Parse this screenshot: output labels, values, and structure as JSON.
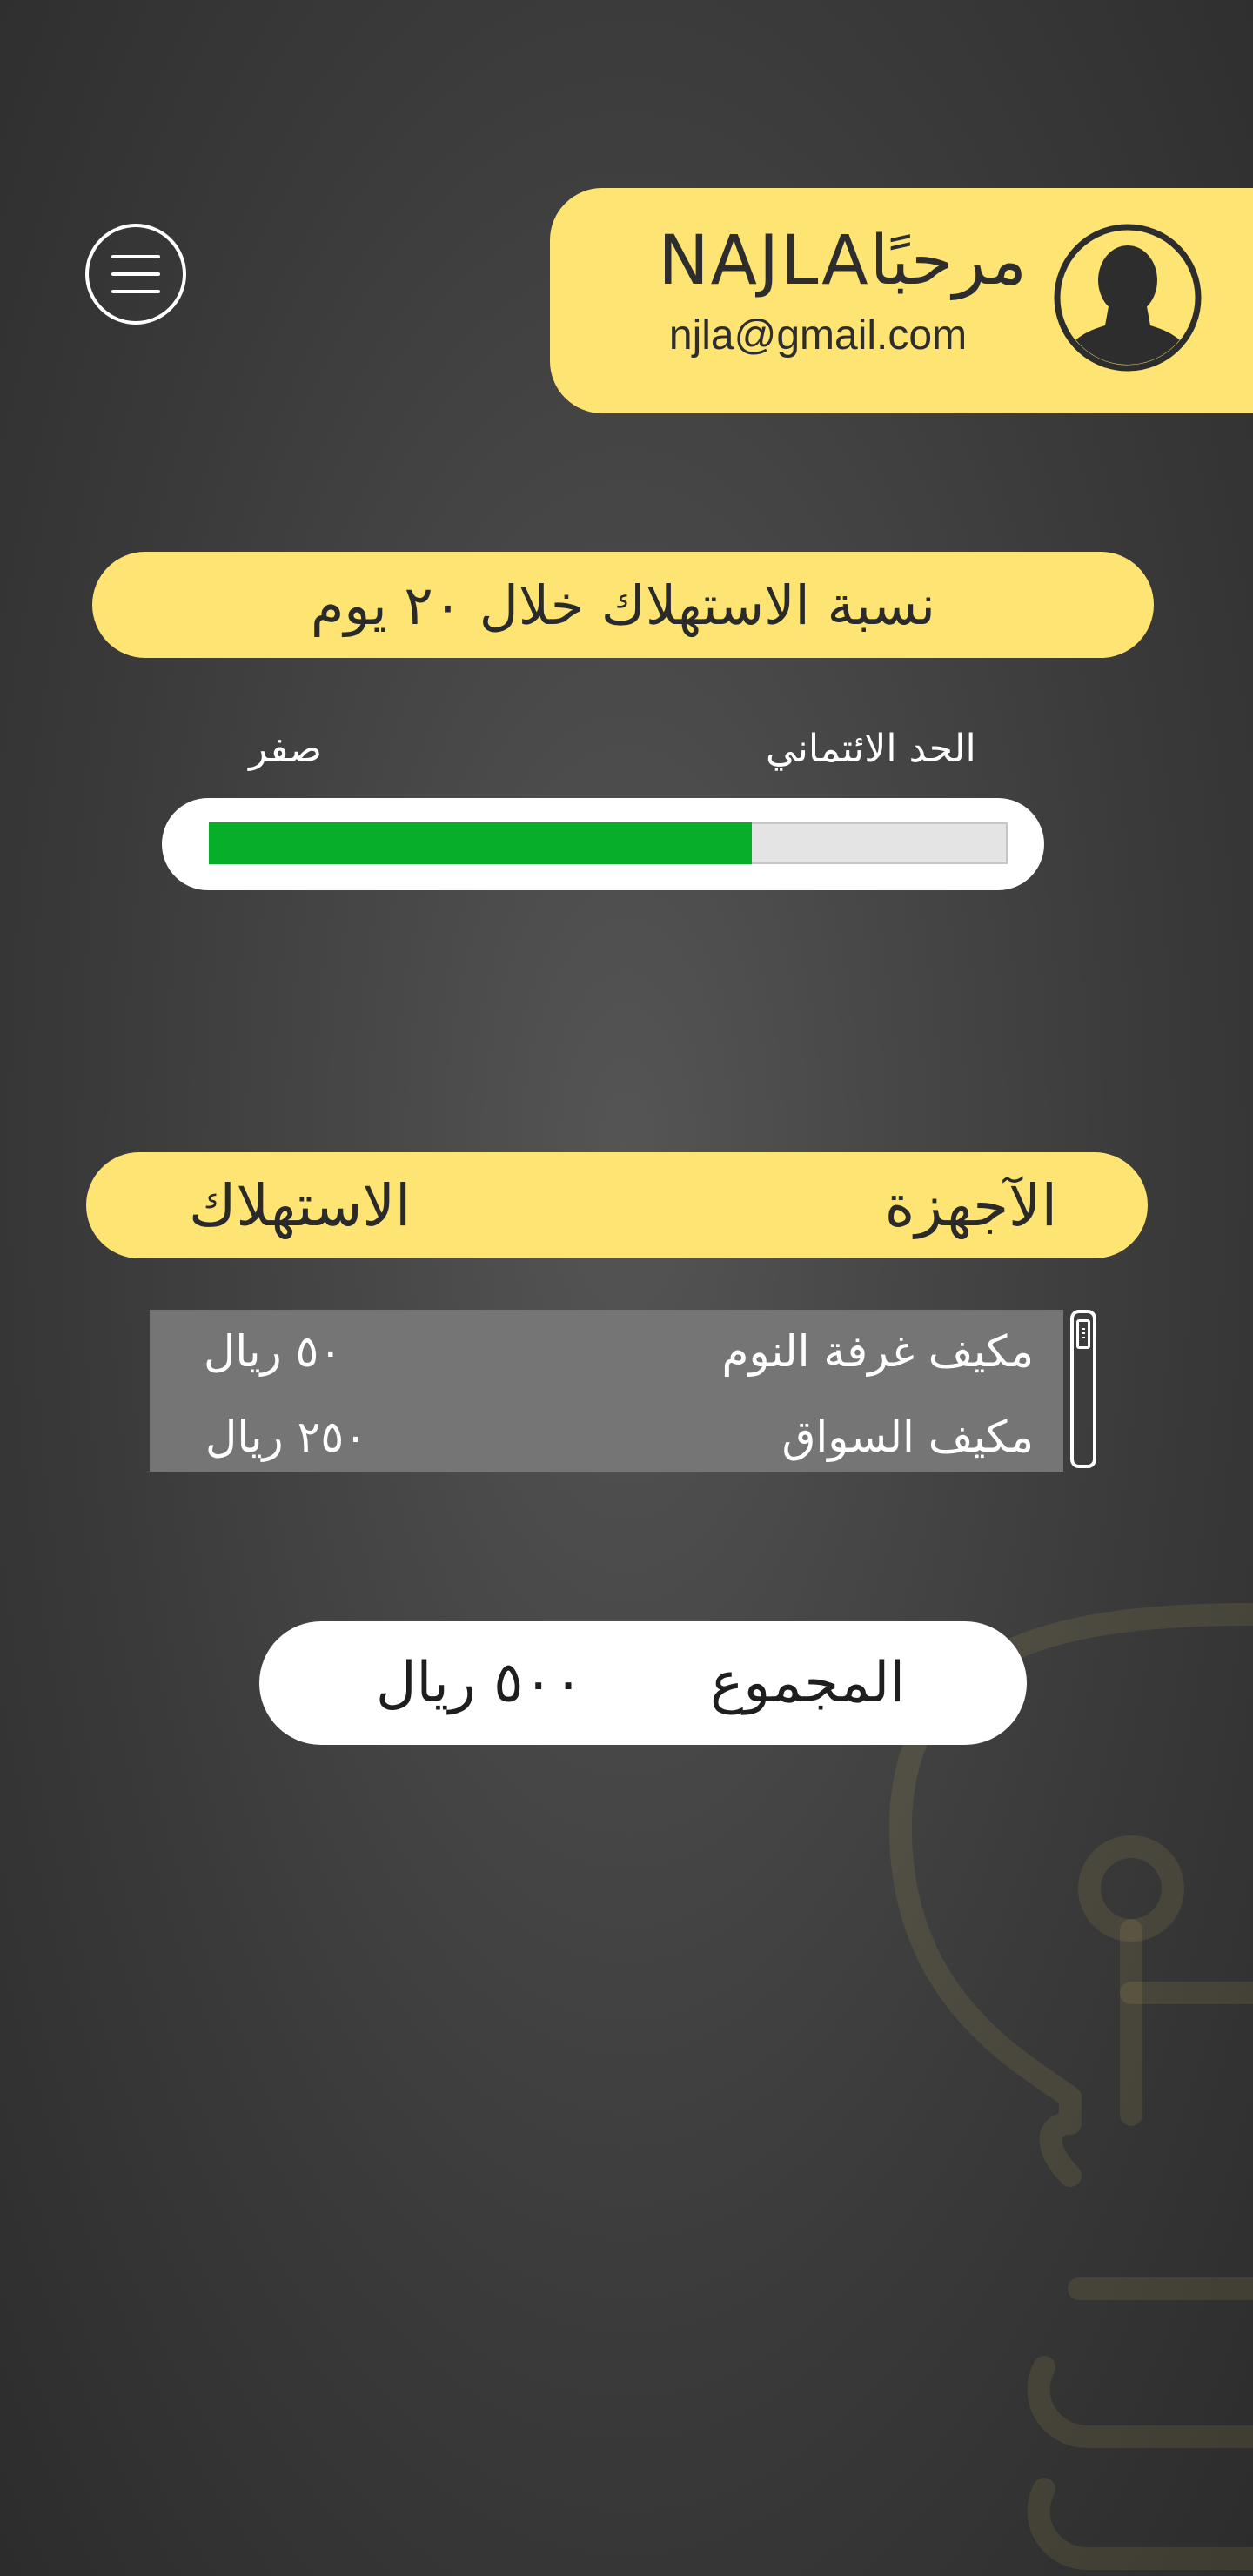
{
  "profile": {
    "greeting_word": "مرحبًا",
    "user_name": "NAJLA",
    "email": "njla@gmail.com",
    "avatar_icon": "user-avatar-icon"
  },
  "menu": {
    "icon": "hamburger-menu-icon"
  },
  "consumption": {
    "title": "نسبة الاستهلاك خلال ٢٠ يوم",
    "max_label": "الحد الائتماني",
    "zero_label": "صفر",
    "progress_fraction": 0.68,
    "progress_color": "#06ae2a"
  },
  "devices": {
    "header_devices": "الآجهزة",
    "header_consumption": "الاستهلاك",
    "rows": [
      {
        "name": "مكيف غرفة النوم",
        "price": "٥٠ ريال"
      },
      {
        "name": "مكيف السواق",
        "price": "٢٥٠ ريال"
      }
    ]
  },
  "total": {
    "label": "المجموع",
    "value": "٥٠٠ ريال"
  },
  "colors": {
    "accent_yellow": "#fde473",
    "background_dark": "#3a3a3a"
  }
}
